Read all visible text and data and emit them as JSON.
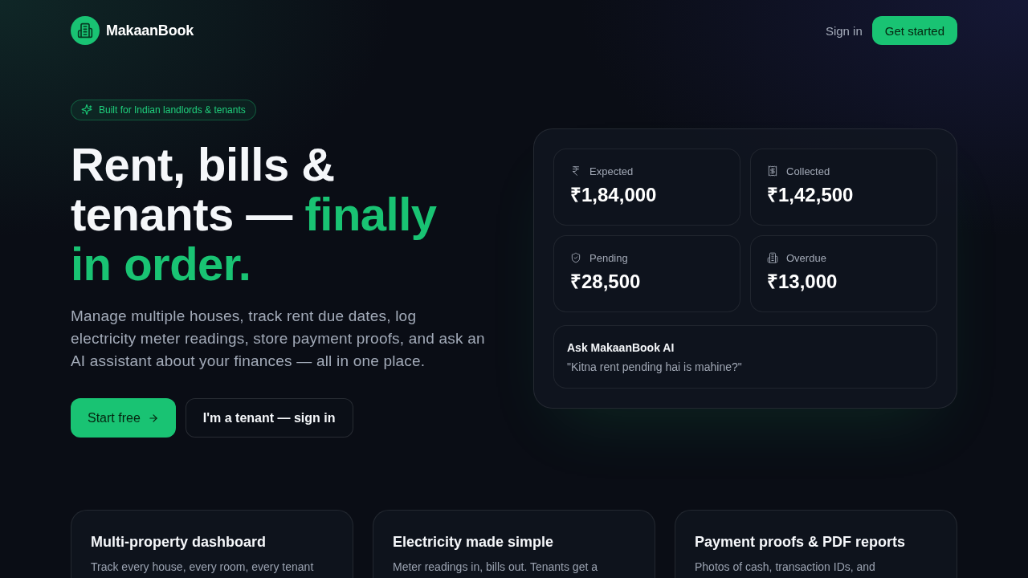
{
  "nav": {
    "brand": "MakaanBook",
    "sign_in": "Sign in",
    "cta": "Get started"
  },
  "hero": {
    "badge": "Built for Indian landlords & tenants",
    "headline": "Rent, bills & tenants —",
    "headline_highlight": "finally in order.",
    "description": "Manage multiple houses, track rent due dates, log electricity meter readings, store payment proofs, and ask an AI assistant about your finances — all in one place.",
    "primary_button": "Start free",
    "secondary_button": "I'm a tenant — sign in"
  },
  "stats": [
    {
      "label": "Expected",
      "value": "₹1,84,000"
    },
    {
      "label": "Collected",
      "value": "₹1,42,500"
    },
    {
      "label": "Pending",
      "value": "₹28,500"
    },
    {
      "label": "Overdue",
      "value": "₹13,000"
    }
  ],
  "assistant": {
    "title": "Ask MakaanBook AI",
    "example": "\"Kitna rent pending hai is mahine?\""
  },
  "features": [
    {
      "title": "Multi-property dashboard",
      "description": "Track every house, every room, every tenant"
    },
    {
      "title": "Electricity made simple",
      "description": "Meter readings in, bills out. Tenants get a"
    },
    {
      "title": "Payment proofs & PDF reports",
      "description": "Photos of cash, transaction IDs, and"
    }
  ]
}
